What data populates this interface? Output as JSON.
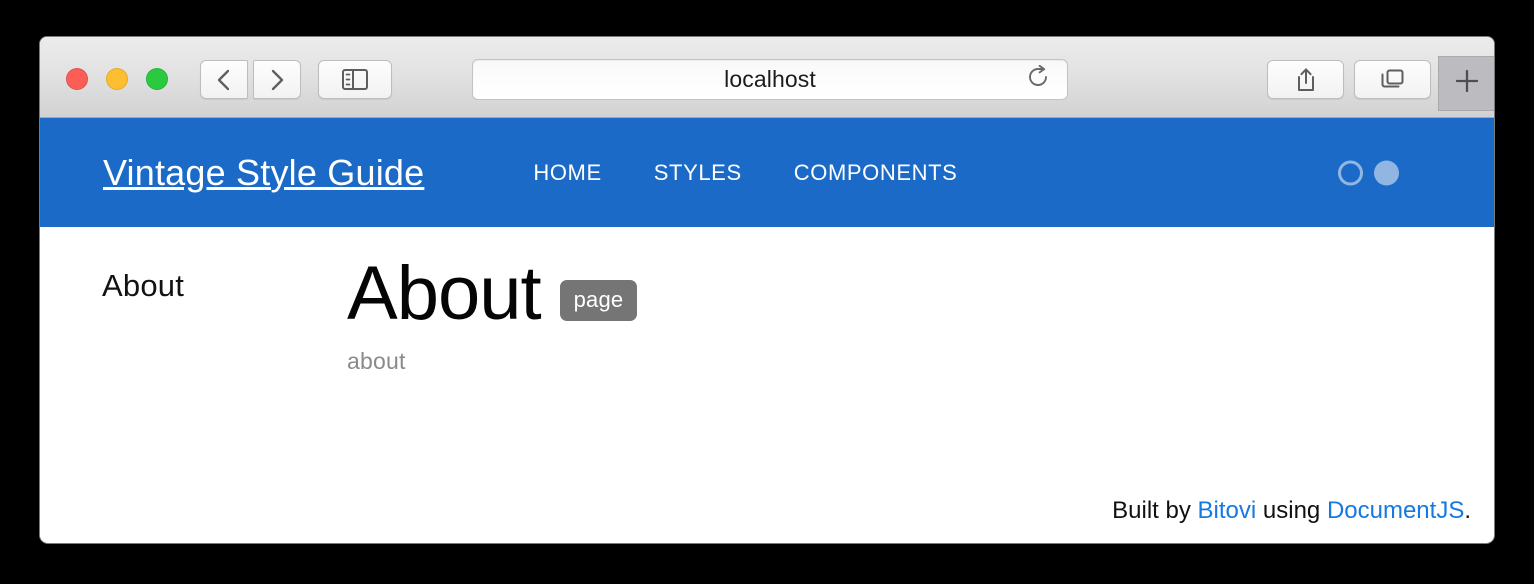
{
  "browser": {
    "address": {
      "value": "localhost",
      "placeholder": "Search or enter website name"
    },
    "traffic_lights": [
      {
        "name": "close",
        "color": "#fa5e57"
      },
      {
        "name": "minimize",
        "color": "#fdbe2f"
      },
      {
        "name": "zoom",
        "color": "#2bc940"
      }
    ],
    "toolbar_icons": [
      "back-icon",
      "forward-icon",
      "sidebar-icon",
      "reload-icon",
      "share-icon",
      "tabs-icon",
      "plus-icon"
    ]
  },
  "site": {
    "brand": "Vintage Style Guide",
    "nav": [
      {
        "label": "HOME"
      },
      {
        "label": "STYLES"
      },
      {
        "label": "COMPONENTS"
      }
    ],
    "indicators": [
      {
        "state": "hollow"
      },
      {
        "state": "filled"
      }
    ],
    "accent_color": "#1b6ac8",
    "indicator_color": "#92b6e2"
  },
  "sidebar": {
    "items": [
      {
        "label": "About"
      }
    ]
  },
  "main": {
    "title": "About",
    "badge": "page",
    "subtitle": "about"
  },
  "footer": {
    "prefix": "Built by ",
    "link1": "Bitovi",
    "middle": " using ",
    "link2": "DocumentJS",
    "suffix": ".",
    "link_color": "#1779e0"
  }
}
